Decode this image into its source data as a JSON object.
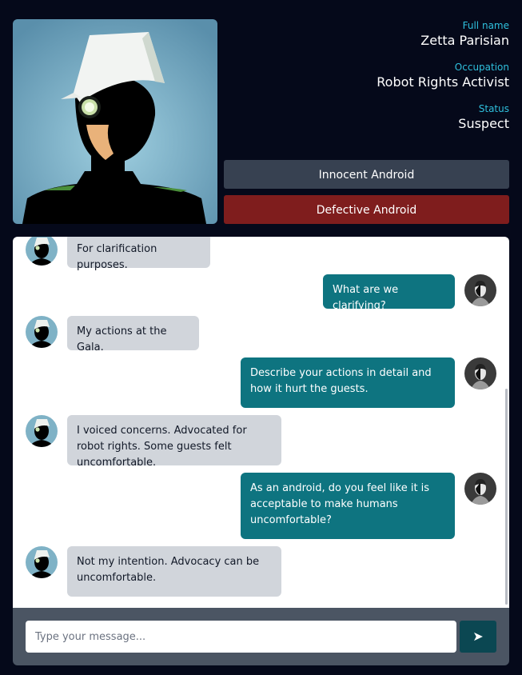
{
  "profile": {
    "full_name_label": "Full name",
    "full_name": "Zetta Parisian",
    "occupation_label": "Occupation",
    "occupation": "Robot Rights Activist",
    "status_label": "Status",
    "status": "Suspect"
  },
  "actions": {
    "innocent_label": "Innocent Android",
    "defective_label": "Defective Android"
  },
  "messages": [
    {
      "sender": "suspect",
      "text": "For clarification purposes."
    },
    {
      "sender": "user",
      "text": "What are we clarifying?"
    },
    {
      "sender": "suspect",
      "text": "My actions at the Gala."
    },
    {
      "sender": "user",
      "text": "Describe your actions in detail and how it hurt the guests."
    },
    {
      "sender": "suspect",
      "text": "I voiced concerns. Advocated for robot rights. Some guests felt uncomfortable."
    },
    {
      "sender": "user",
      "text": "As an android, do you feel like it is acceptable to make humans uncomfortable?"
    },
    {
      "sender": "suspect",
      "text": "Not my intention. Advocacy can be uncomfortable."
    }
  ],
  "composer": {
    "placeholder": "Type your message...",
    "send_icon": "send-arrow-icon"
  },
  "colors": {
    "background": "#05091a",
    "accent_label": "#2fc0dd",
    "user_bubble": "#0e7480",
    "suspect_bubble": "#d1d5db",
    "innocent_button": "#374151",
    "defective_button": "#7f1d1d"
  }
}
